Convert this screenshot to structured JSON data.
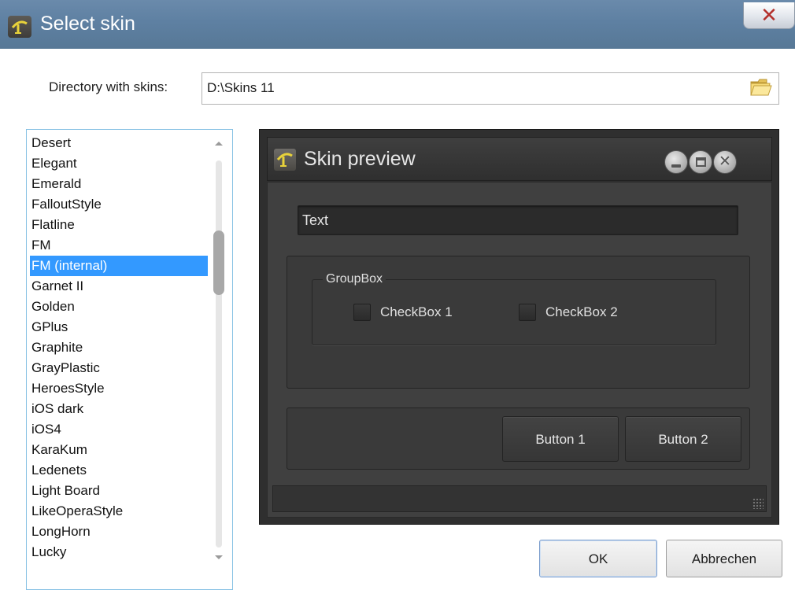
{
  "window": {
    "title": "Select skin",
    "close_glyph": "✕",
    "icon": "skin-logo-icon"
  },
  "directory": {
    "label": "Directory with skins:",
    "value": "D:\\Skins 11",
    "browse_icon": "folder-icon"
  },
  "skin_list": {
    "items": [
      "Desert",
      "Elegant",
      "Emerald",
      "FalloutStyle",
      "Flatline",
      "FM",
      "FM (internal)",
      "Garnet II",
      "Golden",
      "GPlus",
      "Graphite",
      "GrayPlastic",
      "HeroesStyle",
      "iOS dark",
      "iOS4",
      "KaraKum",
      "Ledenets",
      "Light Board",
      "LikeOperaStyle",
      "LongHorn",
      "Lucky"
    ],
    "selected": "FM (internal)"
  },
  "preview": {
    "title": "Skin preview",
    "textbox_value": "Text",
    "groupbox_label": "GroupBox",
    "checkbox1_label": "CheckBox 1",
    "checkbox2_label": "CheckBox 2",
    "button1_label": "Button 1",
    "button2_label": "Button 2",
    "close_glyph": "✕"
  },
  "buttons": {
    "ok_label": "OK",
    "cancel_label": "Abbrechen"
  },
  "colors": {
    "titlebar": "#5e80a2",
    "selection": "#3399ff",
    "preview_bg": "#404040",
    "close_x": "#b3302c"
  }
}
